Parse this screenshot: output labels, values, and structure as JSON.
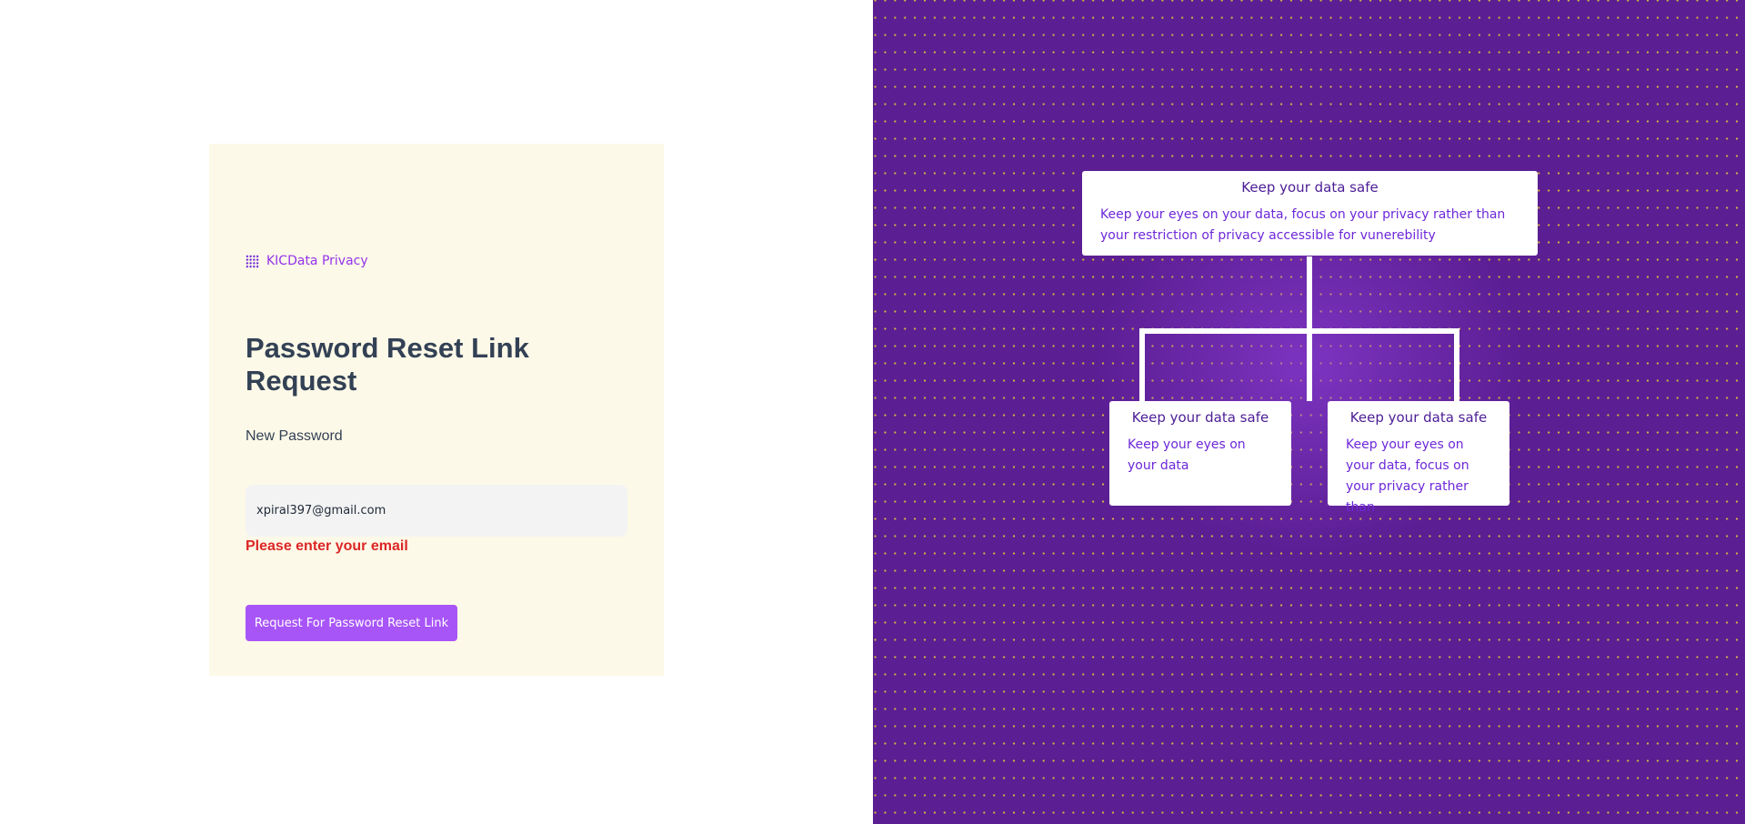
{
  "brand": {
    "name": "KICData Privacy",
    "icon": "grid-dots-icon",
    "color": "#9333ea"
  },
  "form": {
    "title": "Password Reset Link Request",
    "field_label": "New Password",
    "email_value": "xpiral397@gmail.com",
    "error_message": "Please enter your email",
    "submit_label": "Request For Password Reset Link",
    "accent_color": "#a855f7",
    "error_color": "#dc2626"
  },
  "diagram": {
    "background_color": "#5b1e93",
    "root": {
      "title": "Keep your data safe",
      "text": "Keep your eyes on your data, focus on your privacy rather than your restriction of privacy accessible for vunerebility"
    },
    "children": [
      {
        "title": "Keep your data safe",
        "text": "Keep your eyes on your data"
      },
      {
        "title": "Keep your data safe",
        "text": "Keep your eyes on your data, focus on your privacy rather than"
      }
    ]
  }
}
